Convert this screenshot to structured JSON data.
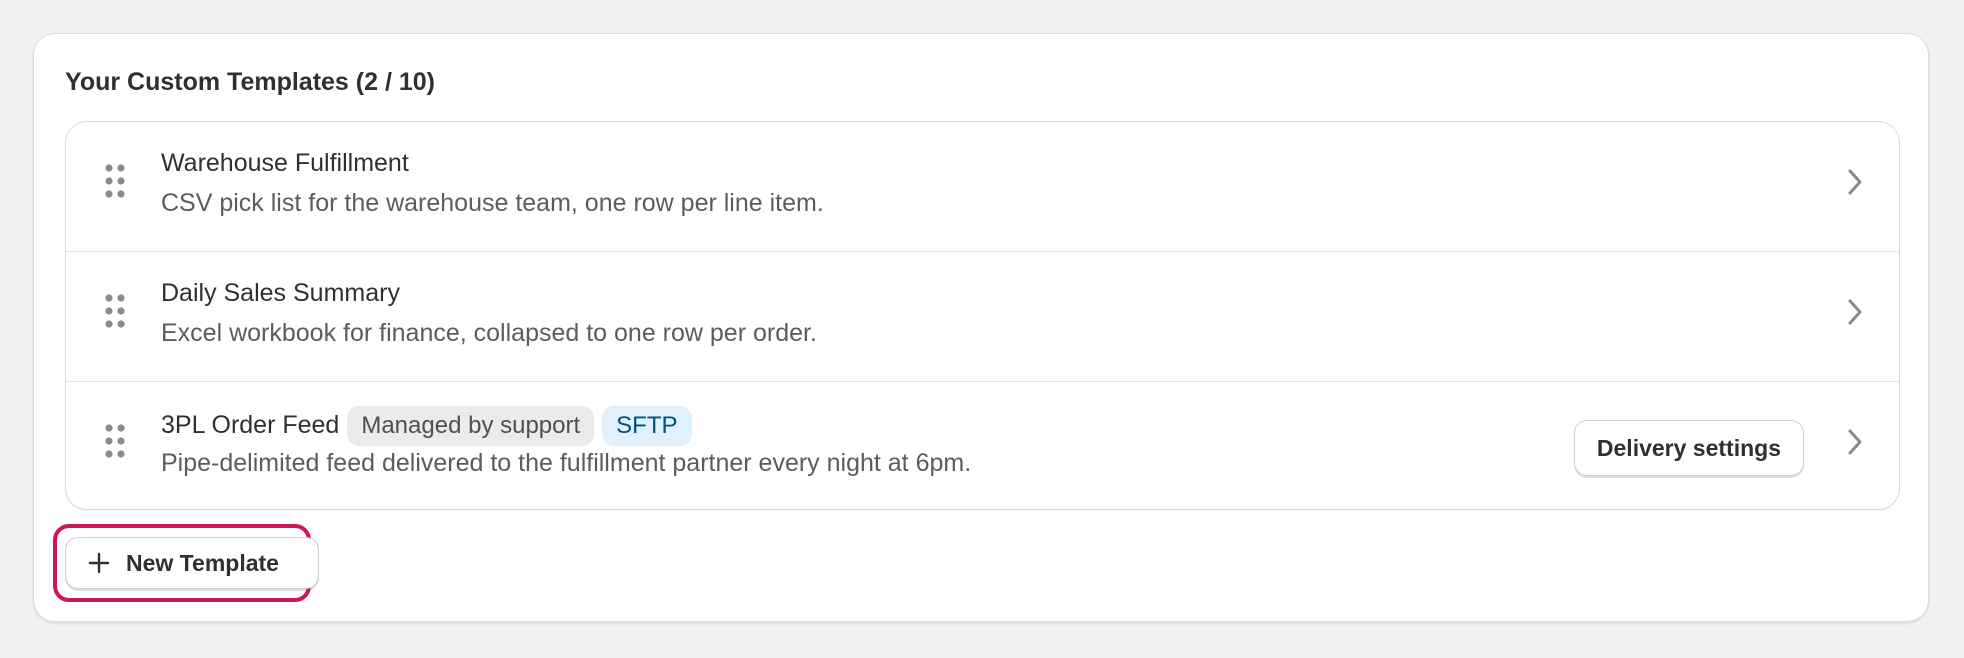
{
  "section": {
    "title": "Your Custom Templates (2 / 10)"
  },
  "templates": [
    {
      "name": "Warehouse Fulfillment",
      "description": "CSV pick list for the warehouse team, one row per line item."
    },
    {
      "name": "Daily Sales Summary",
      "description": "Excel workbook for finance, collapsed to one row per order."
    },
    {
      "name": "3PL Order Feed",
      "badges": [
        "Managed by support",
        "SFTP"
      ],
      "description": "Pipe-delimited feed delivered to the fulfillment partner every night at 6pm.",
      "action_label": "Delivery settings"
    }
  ],
  "new_template_label": "New Template",
  "icons": {
    "drag": "drag-handle-icon",
    "chevron": "chevron-right-icon",
    "plus": "plus-icon"
  },
  "colors": {
    "highlight": "#d0164f",
    "badge_blue_bg": "#e0f0ff",
    "badge_blue_text": "#00527c",
    "badge_grey_bg": "#ebebeb"
  }
}
